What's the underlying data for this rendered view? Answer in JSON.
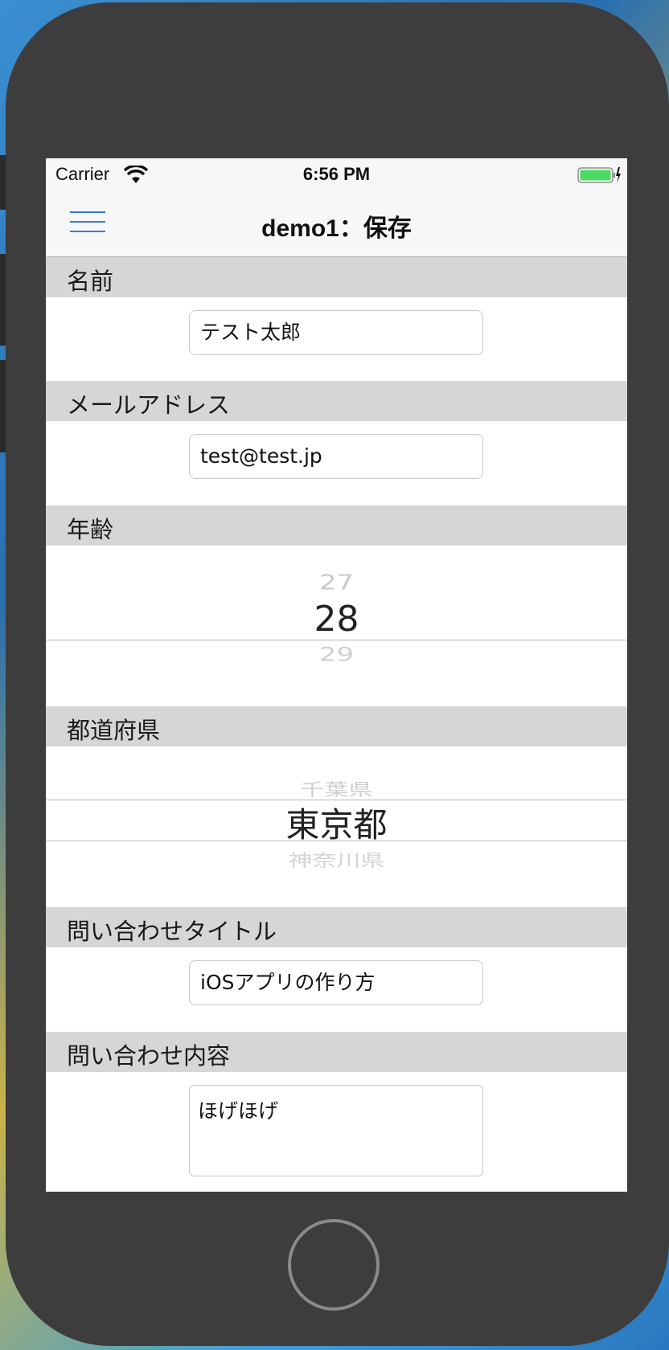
{
  "status_bar": {
    "carrier": "Carrier",
    "time": "6:56 PM",
    "battery_color": "#4cd964"
  },
  "nav": {
    "menu_icon": "hamburger-menu-icon",
    "title": "demo1：保存",
    "accent_color": "#3478f6"
  },
  "form": {
    "name": {
      "label": "名前",
      "value": "テスト太郎"
    },
    "email": {
      "label": "メールアドレス",
      "value": "test@test.jp"
    },
    "age": {
      "label": "年齢",
      "prev": "27",
      "selected": "28",
      "next": "29"
    },
    "prefecture": {
      "label": "都道府県",
      "prev": "千葉県",
      "selected": "東京都",
      "next": "神奈川県"
    },
    "inquiry_title": {
      "label": "問い合わせタイトル",
      "value": "iOSアプリの作り方"
    },
    "inquiry_body": {
      "label": "問い合わせ内容",
      "value": "ほげほげ"
    }
  }
}
